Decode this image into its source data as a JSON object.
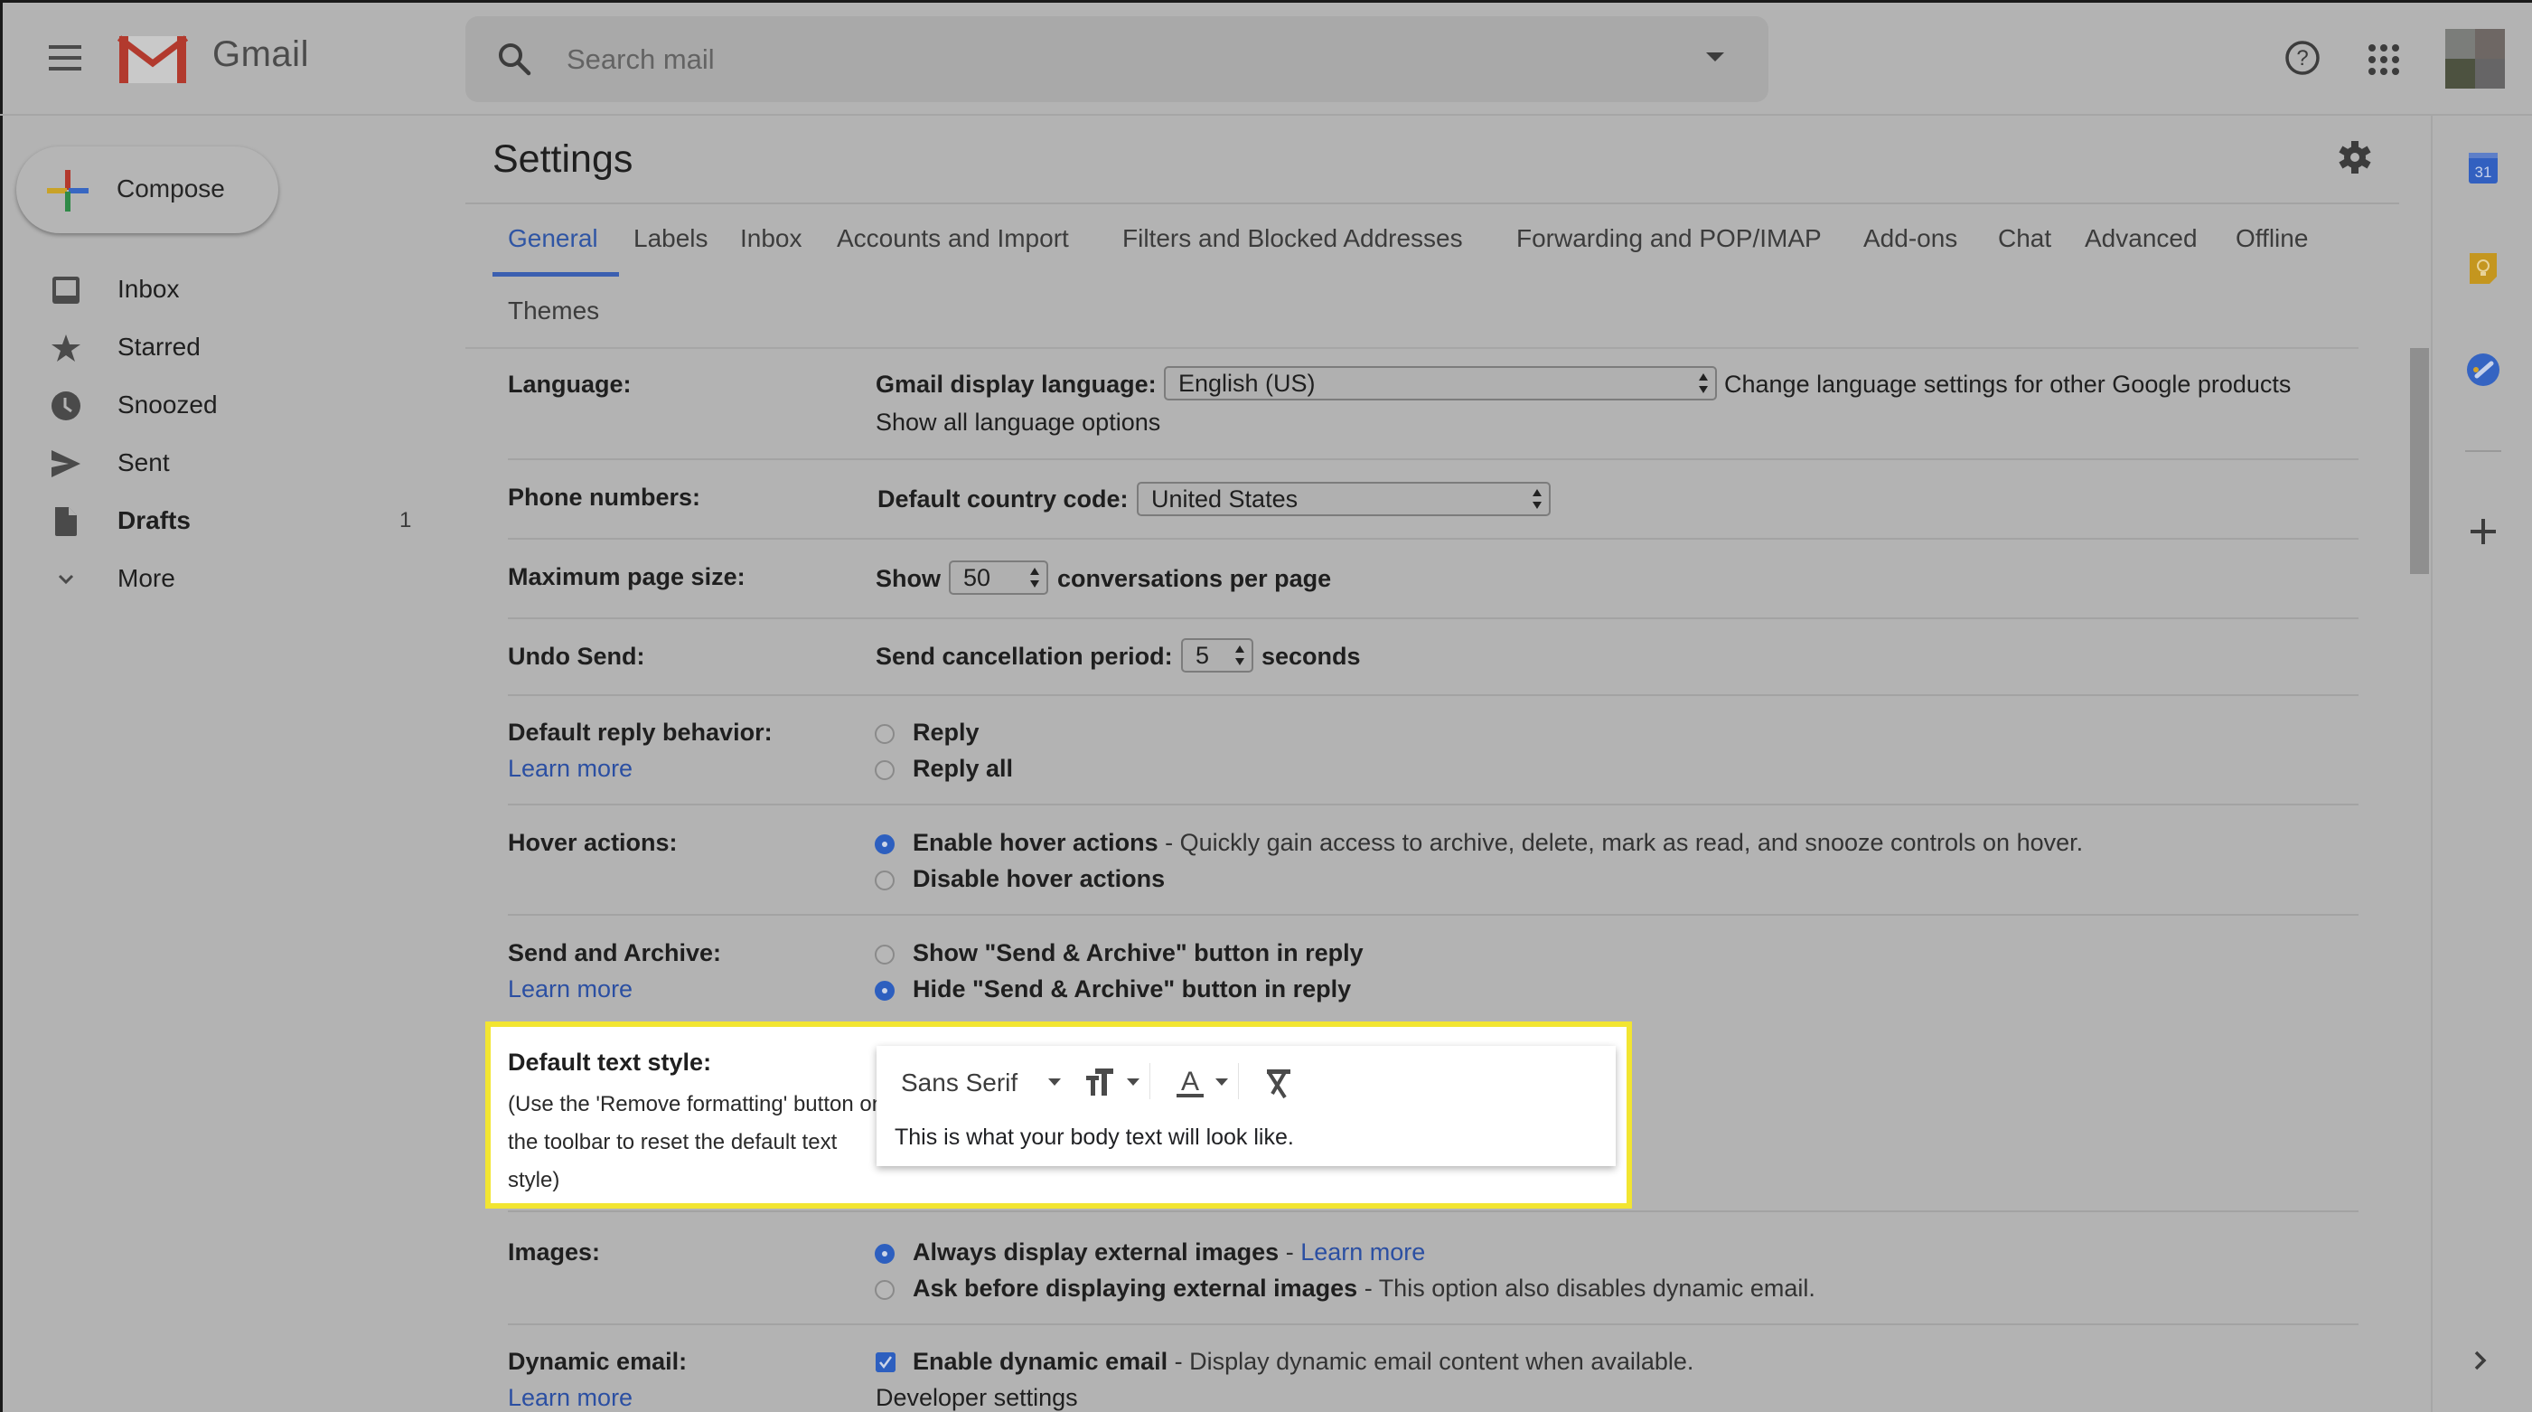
{
  "app": {
    "name": "Gmail"
  },
  "search": {
    "placeholder": "Search mail"
  },
  "header_icons": [
    "main-menu-icon",
    "search-icon",
    "search-options-caret",
    "help-icon",
    "apps-grid-icon",
    "account-avatar"
  ],
  "compose": {
    "label": "Compose"
  },
  "nav": {
    "items": [
      {
        "label": "Inbox",
        "icon": "inbox-icon",
        "bold": false,
        "count": ""
      },
      {
        "label": "Starred",
        "icon": "star-icon",
        "bold": false,
        "count": ""
      },
      {
        "label": "Snoozed",
        "icon": "clock-icon",
        "bold": false,
        "count": ""
      },
      {
        "label": "Sent",
        "icon": "send-icon",
        "bold": false,
        "count": ""
      },
      {
        "label": "Drafts",
        "icon": "draft-icon",
        "bold": true,
        "count": "1"
      },
      {
        "label": "More",
        "icon": "chevron-down-icon",
        "bold": false,
        "count": ""
      }
    ]
  },
  "settings": {
    "title": "Settings",
    "tabs": [
      {
        "label": "General",
        "active": true
      },
      {
        "label": "Labels",
        "active": false
      },
      {
        "label": "Inbox",
        "active": false
      },
      {
        "label": "Accounts and Import",
        "active": false
      },
      {
        "label": "Filters and Blocked Addresses",
        "active": false
      },
      {
        "label": "Forwarding and POP/IMAP",
        "active": false
      },
      {
        "label": "Add-ons",
        "active": false
      },
      {
        "label": "Chat",
        "active": false
      },
      {
        "label": "Advanced",
        "active": false
      },
      {
        "label": "Offline",
        "active": false
      },
      {
        "label": "Themes",
        "active": false
      }
    ],
    "language": {
      "label": "Language:",
      "field_label": "Gmail display language:",
      "value": "English (US)",
      "change_link": "Change language settings for other Google products",
      "show_all_link": "Show all language options"
    },
    "phone": {
      "label": "Phone numbers:",
      "field_label": "Default country code:",
      "value": "United States"
    },
    "page_size": {
      "label": "Maximum page size:",
      "prefix": "Show",
      "value": "50",
      "suffix": "conversations per page"
    },
    "undo_send": {
      "label": "Undo Send:",
      "field_label": "Send cancellation period:",
      "value": "5",
      "suffix": "seconds"
    },
    "reply": {
      "label": "Default reply behavior:",
      "learn_more": "Learn more",
      "options": [
        {
          "label": "Reply",
          "selected": false
        },
        {
          "label": "Reply all",
          "selected": false
        }
      ]
    },
    "hover": {
      "label": "Hover actions:",
      "options": [
        {
          "label": "Enable hover actions",
          "desc": " - Quickly gain access to archive, delete, mark as read, and snooze controls on hover.",
          "selected": true
        },
        {
          "label": "Disable hover actions",
          "desc": "",
          "selected": false
        }
      ]
    },
    "send_archive": {
      "label": "Send and Archive:",
      "learn_more": "Learn more",
      "options": [
        {
          "label": "Show \"Send & Archive\" button in reply",
          "selected": false
        },
        {
          "label": "Hide \"Send & Archive\" button in reply",
          "selected": true
        }
      ]
    },
    "text_style": {
      "label": "Default text style:",
      "help": "(Use the 'Remove formatting' button on the toolbar to reset the default text style)",
      "font": "Sans Serif",
      "sample": "This is what your body text will look like.",
      "highlight_color": "#f2e531"
    },
    "images": {
      "label": "Images:",
      "options": [
        {
          "label": "Always display external images",
          "desc": " - ",
          "link": "Learn more",
          "selected": true
        },
        {
          "label": "Ask before displaying external images",
          "desc": " - This option also disables dynamic email.",
          "selected": false
        }
      ]
    },
    "dynamic_email": {
      "label": "Dynamic email:",
      "learn_more": "Learn more",
      "checkbox_label": "Enable dynamic email",
      "checked": true,
      "desc": " - Display dynamic email content when available.",
      "developer_link": "Developer settings"
    }
  },
  "colors": {
    "accent": "#2d5fbf",
    "link": "#2b4fa2",
    "overlay_bg": "#b3b3b3"
  }
}
